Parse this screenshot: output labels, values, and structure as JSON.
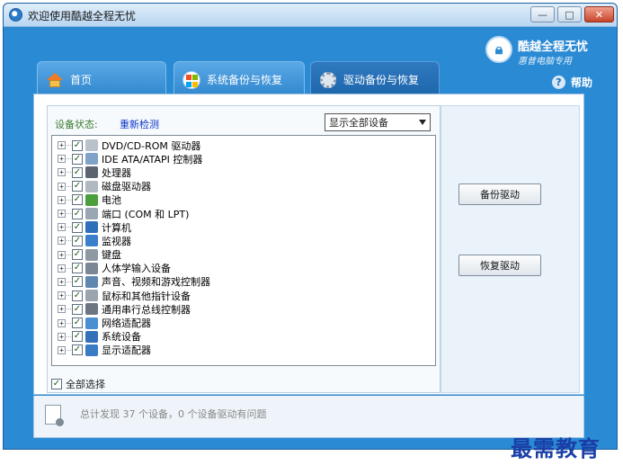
{
  "window": {
    "title": "欢迎使用酷越全程无忧"
  },
  "controls": {
    "minimize": "—",
    "maximize": "□",
    "close": "✕"
  },
  "brand": {
    "name": "酷越全程无忧",
    "subtitle": "惠普电脑专用"
  },
  "help": {
    "label": "帮助",
    "icon_text": "?"
  },
  "tabs": [
    {
      "label": "首页",
      "icon": "home-icon"
    },
    {
      "label": "系统备份与恢复",
      "icon": "windows-logo-icon"
    },
    {
      "label": "驱动备份与恢复",
      "icon": "gear-icon"
    }
  ],
  "device_panel": {
    "status_label": "设备状态:",
    "redetect_label": "重新检测",
    "filter_value": "显示全部设备",
    "select_all_label": "全部选择"
  },
  "devices": [
    {
      "label": "DVD/CD-ROM 驱动器",
      "icon_color": "#b9c2cb"
    },
    {
      "label": "IDE ATA/ATAPI 控制器",
      "icon_color": "#7fa3c8"
    },
    {
      "label": "处理器",
      "icon_color": "#5b6470"
    },
    {
      "label": "磁盘驱动器",
      "icon_color": "#b0b8c0"
    },
    {
      "label": "电池",
      "icon_color": "#4a9e3b"
    },
    {
      "label": "端口 (COM 和 LPT)",
      "icon_color": "#9aa6b3"
    },
    {
      "label": "计算机",
      "icon_color": "#2f6fba"
    },
    {
      "label": "监视器",
      "icon_color": "#3a7fcb"
    },
    {
      "label": "键盘",
      "icon_color": "#8e98a3"
    },
    {
      "label": "人体学输入设备",
      "icon_color": "#7b8795"
    },
    {
      "label": "声音、视频和游戏控制器",
      "icon_color": "#5f87b0"
    },
    {
      "label": "鼠标和其他指针设备",
      "icon_color": "#9aa4ae"
    },
    {
      "label": "通用串行总线控制器",
      "icon_color": "#6c7683"
    },
    {
      "label": "网络适配器",
      "icon_color": "#4b8fd0"
    },
    {
      "label": "系统设备",
      "icon_color": "#3372b8"
    },
    {
      "label": "显示适配器",
      "icon_color": "#3a7cc4"
    }
  ],
  "actions": {
    "backup_label": "备份驱动",
    "restore_label": "恢复驱动"
  },
  "footer": {
    "summary": "总计发现 37 个设备，0 个设备驱动有问题"
  },
  "watermark": "最需教育",
  "colors": {
    "accent": "#2a8ad4",
    "link": "#0a35c7",
    "status_green": "#3b7a2f"
  }
}
